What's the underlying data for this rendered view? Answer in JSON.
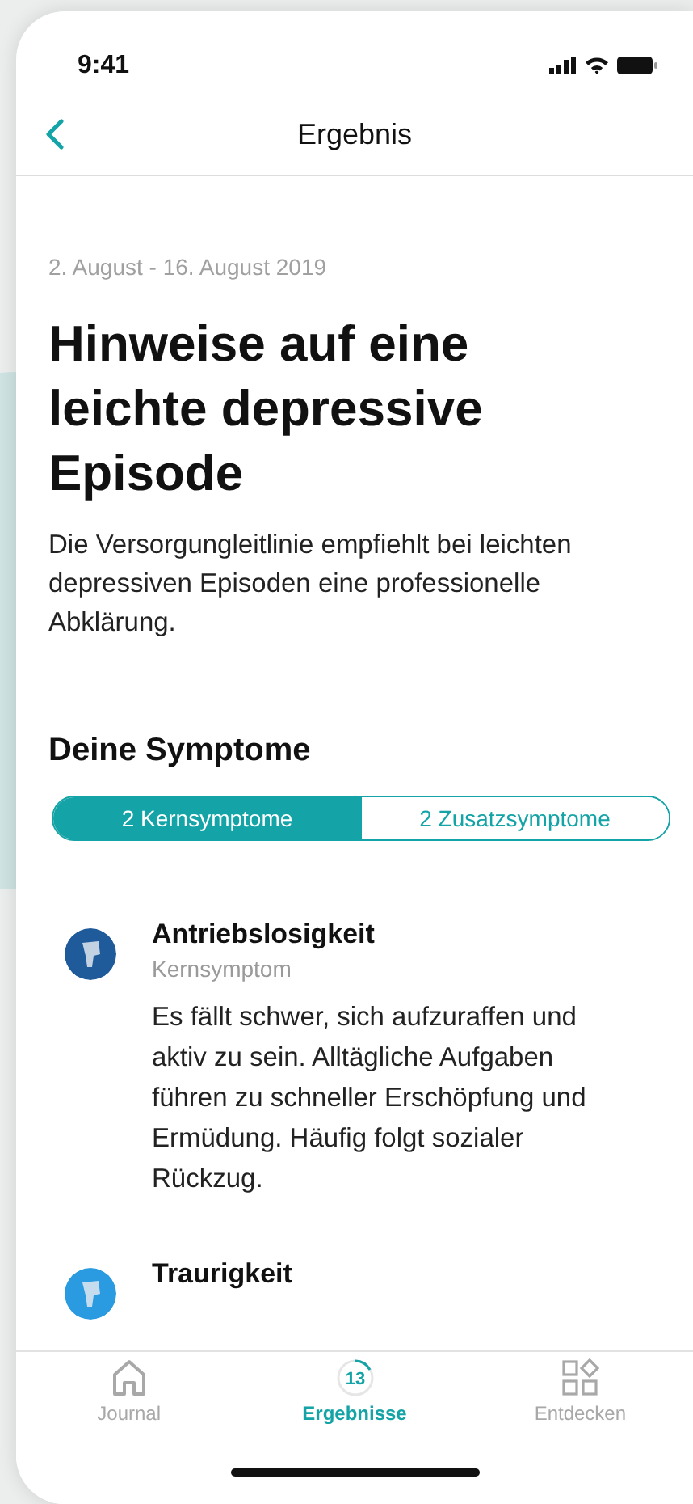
{
  "status_bar": {
    "time": "9:41"
  },
  "nav": {
    "title": "Ergebnis"
  },
  "period": "2. August - 16. August 2019",
  "headline": "Hinweise auf eine leichte depressive Episode",
  "description": "Die Versorgungleitlinie empfiehlt bei leichten depressiven Episoden eine professionelle Abklärung.",
  "section_title": "Deine Symptome",
  "segments": [
    {
      "label": "2 Kernsymptome",
      "selected": true
    },
    {
      "label": "2 Zusatzsymptome",
      "selected": false
    }
  ],
  "symptoms": [
    {
      "name": "Antriebslosigkeit",
      "type": "Kernsymptom",
      "text": "Es fällt schwer, sich aufzuraffen und aktiv zu sein. Alltägliche Aufgaben führen zu schneller Erschöpfung und Ermüdung. Häufig folgt sozialer Rückzug.",
      "color": "#1f5a9a"
    },
    {
      "name": "Traurigkeit",
      "color": "#2a9be0"
    }
  ],
  "tab_bar": [
    {
      "kind": "home",
      "label": "Journal",
      "selected": false
    },
    {
      "kind": "counter",
      "label": "Ergebnisse",
      "badge": "13",
      "selected": true
    },
    {
      "kind": "grid",
      "label": "Entdecken",
      "selected": false
    }
  ]
}
